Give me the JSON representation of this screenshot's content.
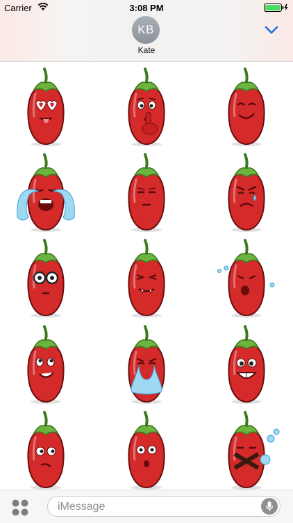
{
  "status_bar": {
    "carrier": "Carrier",
    "time": "3:08 PM"
  },
  "header": {
    "avatar_initials": "KB",
    "contact_name": "Kate"
  },
  "stickers": [
    {
      "name": "pepper-heart-eyes-tongue"
    },
    {
      "name": "pepper-shush"
    },
    {
      "name": "pepper-smirk"
    },
    {
      "name": "pepper-crying-loud"
    },
    {
      "name": "pepper-unamused"
    },
    {
      "name": "pepper-angry-tear"
    },
    {
      "name": "pepper-goggle-eyes"
    },
    {
      "name": "pepper-grimace-fangs"
    },
    {
      "name": "pepper-sneeze"
    },
    {
      "name": "pepper-dreamy"
    },
    {
      "name": "pepper-tears-stream"
    },
    {
      "name": "pepper-big-grin"
    },
    {
      "name": "pepper-side-eye"
    },
    {
      "name": "pepper-shocked"
    },
    {
      "name": "pepper-silenced"
    }
  ],
  "input": {
    "placeholder": "iMessage"
  },
  "colors": {
    "pepper": "#d42a2a",
    "stem": "#6cb33f",
    "accent": "#1a6fe0"
  }
}
